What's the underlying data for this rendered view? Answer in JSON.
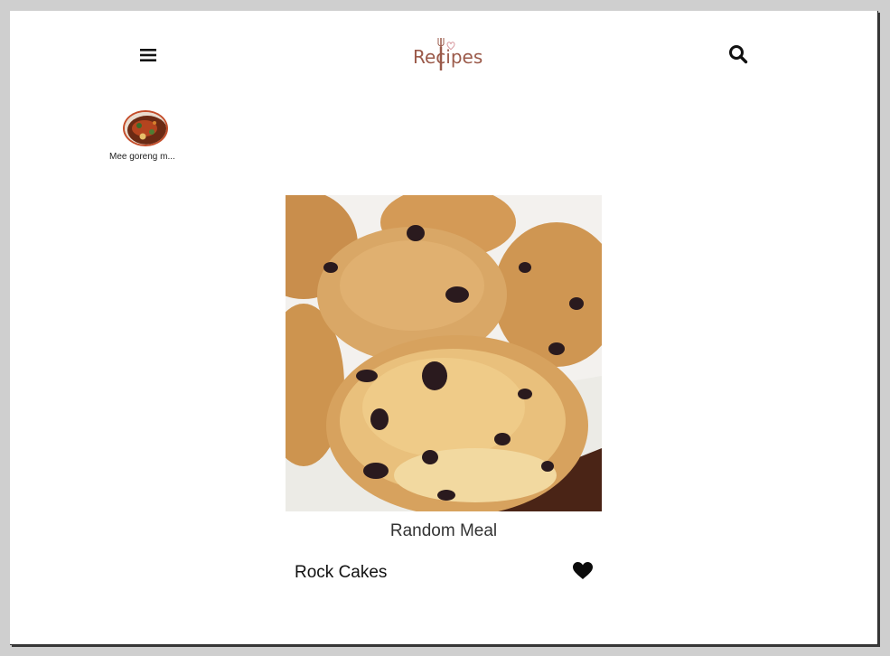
{
  "header": {
    "logo_text": "Recipes",
    "menu_icon": "hamburger-menu-icon",
    "search_icon": "search-icon"
  },
  "favorites": [
    {
      "name": "Mee goreng m..."
    }
  ],
  "meal": {
    "section_label": "Random Meal",
    "title": "Rock Cakes",
    "favorite_icon": "heart-icon"
  }
}
